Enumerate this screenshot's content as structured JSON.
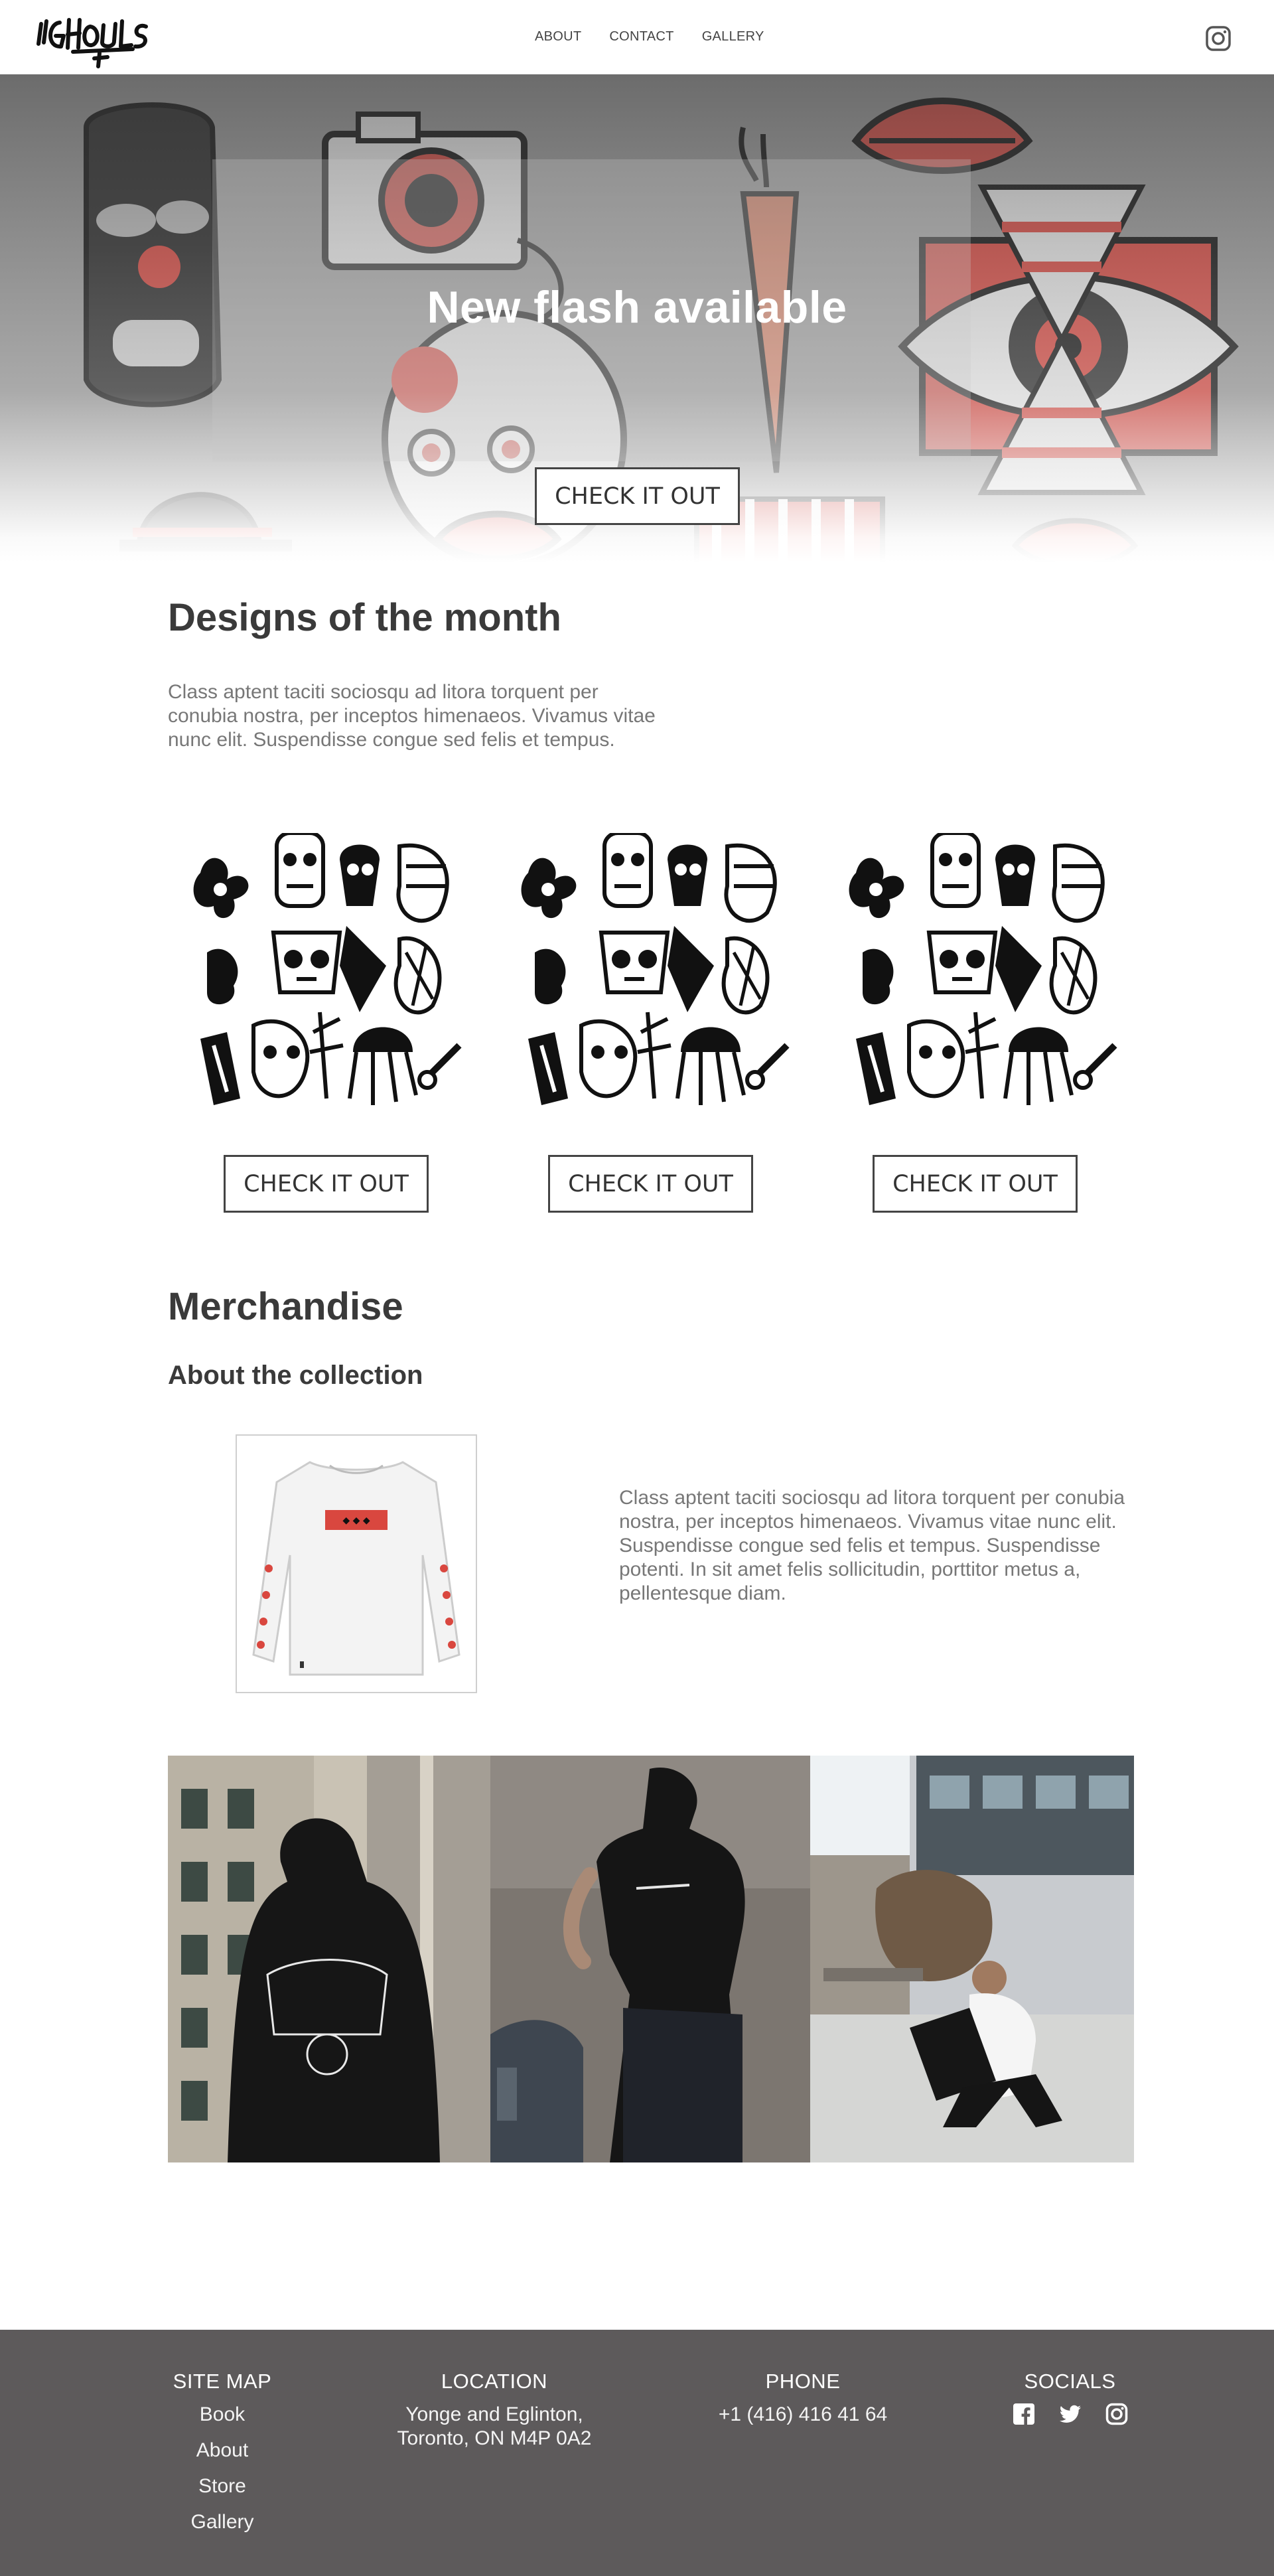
{
  "brand": {
    "logo_text": "GHOUIS"
  },
  "nav": {
    "links": [
      "ABOUT",
      "CONTACT",
      "GALLERY"
    ]
  },
  "hero": {
    "title": "New flash available",
    "button_label": "CHECK IT OUT"
  },
  "designs": {
    "title": "Designs of the month",
    "text": "Class aptent taciti sociosqu ad litora torquent per conubia nostra, per inceptos himenaeos. Vivamus vitae nunc elit. Suspendisse congue sed felis et tempus.",
    "cards": [
      {
        "button_label": "CHECK IT OUT"
      },
      {
        "button_label": "CHECK IT OUT"
      },
      {
        "button_label": "CHECK IT OUT"
      }
    ]
  },
  "merch": {
    "title": "Merchandise",
    "subtitle": "About the collection",
    "text": "Class aptent taciti sociosqu ad litora torquent per conubia nostra, per inceptos himenaeos. Vivamus vitae nunc elit. Suspendisse congue sed felis et tempus. Suspendisse potenti. In sit amet felis sollicitudin, porttitor metus a, pellentesque diam."
  },
  "footer": {
    "sitemap": {
      "heading": "SITE MAP",
      "links": [
        "Book",
        "About",
        "Store",
        "Gallery"
      ]
    },
    "location": {
      "heading": "LOCATION",
      "line1": "Yonge and Eglinton,",
      "line2": "Toronto, ON M4P 0A2"
    },
    "phone": {
      "heading": "PHONE",
      "number": "+1 (416) 416 41 64"
    },
    "socials": {
      "heading": "SOCIALS",
      "icons": [
        "facebook-icon",
        "twitter-icon",
        "instagram-icon"
      ]
    }
  },
  "colors": {
    "accent_red": "#d9473f",
    "footer_bg": "#5d5a5b",
    "text_dark": "#3a3a3a",
    "text_muted": "#777777"
  }
}
